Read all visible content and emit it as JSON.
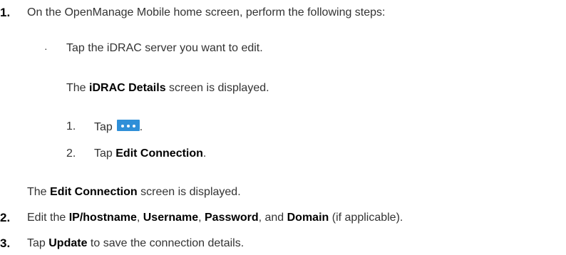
{
  "steps": {
    "s1": {
      "num": "1.",
      "text": "On the OpenManage Mobile home screen, perform the following steps:",
      "bullet": "·",
      "bullet_text": "Tap the iDRAC server you want to edit.",
      "result_pre": "The ",
      "result_bold": "iDRAC Details",
      "result_post": " screen is displayed.",
      "sub": [
        {
          "num": "1.",
          "pre": "Tap",
          "icon": "more-ellipsis-icon",
          "post": "."
        },
        {
          "num": "2.",
          "pre": "Tap ",
          "bold": "Edit Connection",
          "post": "."
        }
      ],
      "after_pre": "The ",
      "after_bold": "Edit Connection",
      "after_post": " screen is displayed."
    },
    "s2": {
      "num": "2.",
      "pre": "Edit the ",
      "b1": "IP/hostname",
      "sep1": ", ",
      "b2": "Username",
      "sep2": ", ",
      "b3": "Password",
      "sep3": ", and ",
      "b4": "Domain",
      "post": " (if applicable)."
    },
    "s3": {
      "num": "3.",
      "pre": "Tap ",
      "b1": "Update",
      "post": " to save the connection details."
    }
  },
  "colors": {
    "text": "#333333",
    "bold": "#000000",
    "icon_bg": "#2f8fd8",
    "icon_fg": "#ffffff"
  }
}
